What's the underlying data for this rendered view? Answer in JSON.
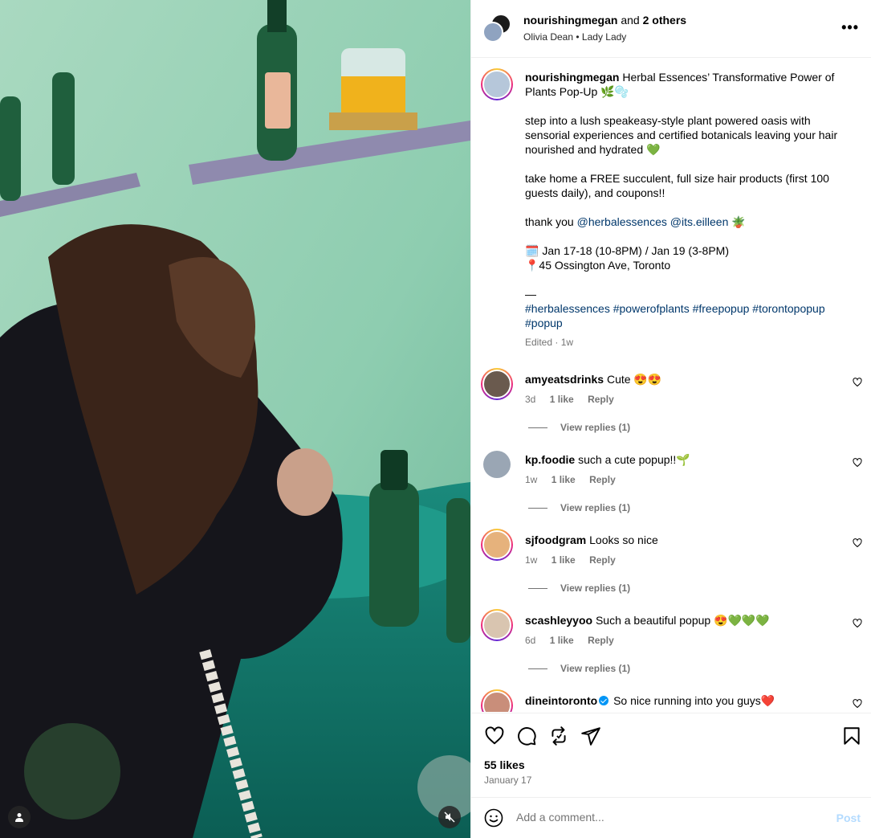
{
  "header": {
    "username": "nourishingmegan",
    "and_text": "and",
    "others": "2 others",
    "music_artist": "Olivia Dean",
    "music_separator": "•",
    "music_title": "Lady Lady"
  },
  "caption": {
    "username": "nourishingmegan",
    "title_text": "Herbal Essences’ Transformative Power of Plants Pop-Up 🌿🫧",
    "para1": "step into a lush speakeasy-style plant powered oasis with sensorial experiences and certified botanicals leaving your hair nourished and hydrated 💚",
    "para2": "take home a FREE succulent, full size hair products (first 100 guests daily), and coupons!!",
    "thanks_prefix": "thank you",
    "mention1": "@herbalessences",
    "mention2": "@its.eilleen",
    "thanks_suffix": "🪴",
    "dates_line": "🗓️ Jan 17-18 (10-8PM) / Jan 19 (3-8PM)",
    "location_line": "📍45 Ossington Ave, Toronto",
    "dash": "—",
    "hashtags": "#herbalessences #powerofplants #freepopup #torontopopup #popup",
    "edited": "Edited",
    "meta_sep": "·",
    "time": "1w"
  },
  "comments": [
    {
      "username": "amyeatsdrinks",
      "text": "Cute 😍😍",
      "time": "3d",
      "likes": "1 like",
      "reply": "Reply",
      "view_replies": "View replies (1)",
      "verified": false
    },
    {
      "username": "kp.foodie",
      "text": "such a cute popup!!🌱",
      "time": "1w",
      "likes": "1 like",
      "reply": "Reply",
      "view_replies": "View replies (1)",
      "verified": false
    },
    {
      "username": "sjfoodgram",
      "text": "Looks so nice",
      "time": "1w",
      "likes": "1 like",
      "reply": "Reply",
      "view_replies": "View replies (1)",
      "verified": false
    },
    {
      "username": "scashleyyoo",
      "text": "Such a beautiful popup 😍💚💚💚",
      "time": "6d",
      "likes": "1 like",
      "reply": "Reply",
      "view_replies": "View replies (1)",
      "verified": false
    },
    {
      "username": "dineintoronto",
      "text": "So nice running into you guys❤️",
      "verified": true
    }
  ],
  "footer": {
    "likes": "55 likes",
    "date": "January 17",
    "comment_placeholder": "Add a comment...",
    "post_label": "Post"
  },
  "icons": {
    "like": "heart-icon",
    "comment": "comment-icon",
    "repost": "repost-icon",
    "share": "send-icon",
    "save": "bookmark-icon",
    "emoji": "emoji-icon",
    "tag": "user-tag-icon",
    "mute": "muted-speaker-icon",
    "more": "more-options-icon"
  },
  "colors": {
    "link": "#00376b",
    "muted": "#737373",
    "post_disabled": "#b3dbff",
    "verified": "#0095f6"
  }
}
